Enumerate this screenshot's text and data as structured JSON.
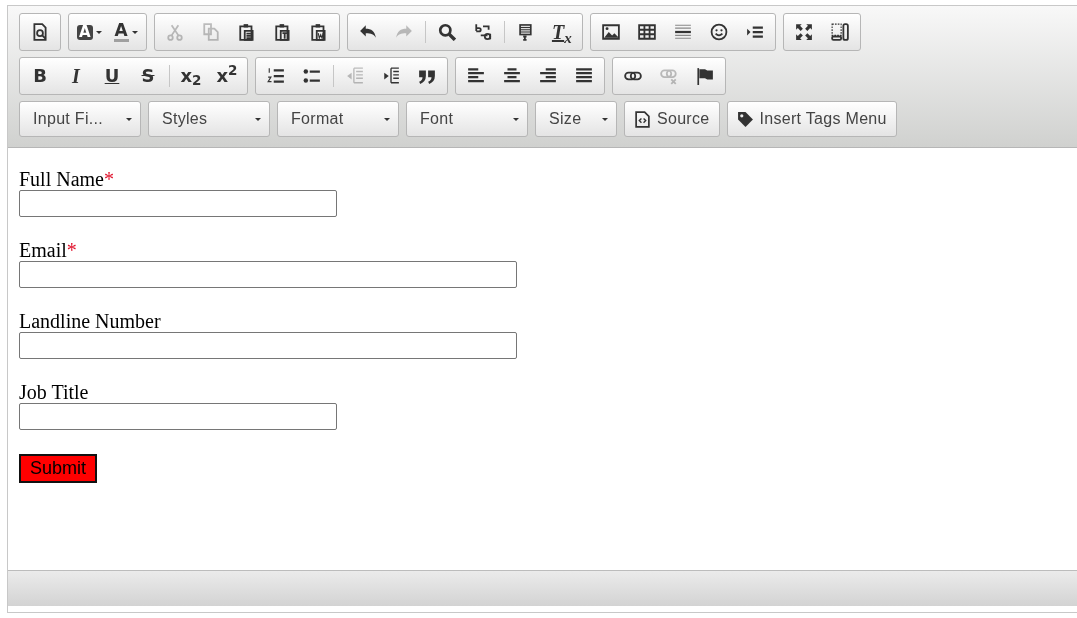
{
  "toolbar": {
    "rows": [
      {
        "groups": [
          [
            {
              "disabled": false
            }
          ],
          [
            {
              "glyph": "A",
              "disabled": false
            },
            {
              "glyph": "A",
              "disabled": false
            }
          ],
          [
            {
              "disabled": true
            },
            {
              "disabled": true
            },
            {
              "disabled": false
            },
            {
              "disabled": false
            },
            {
              "disabled": false
            }
          ],
          [
            {
              "disabled": false
            },
            {
              "disabled": true
            },
            {
              "disabled": false
            },
            {
              "disabled": false
            },
            {
              "disabled": false
            },
            {
              "glyph": "T$_{x}$",
              "disabled": false
            }
          ],
          [
            {
              "disabled": false
            },
            {
              "disabled": false
            },
            {
              "disabled": false
            },
            {
              "disabled": false
            },
            {
              "disabled": false
            }
          ],
          [
            {
              "disabled": false
            },
            {
              "disabled": false
            }
          ]
        ]
      },
      {
        "groups": [
          [
            {
              "glyph": "B",
              "disabled": false
            },
            {
              "glyph": "I",
              "disabled": false
            },
            {
              "glyph": "U",
              "disabled": false
            },
            {
              "glyph": "S",
              "disabled": false
            },
            {
              "glyph": "x$_{2}$",
              "disabled": false
            },
            {
              "glyph": "x$^{2}$",
              "disabled": false
            }
          ],
          [
            {
              "disabled": false
            },
            {
              "disabled": false
            },
            {
              "disabled": true
            },
            {
              "disabled": false
            },
            {
              "disabled": false
            }
          ],
          [
            {
              "disabled": false
            },
            {
              "disabled": false
            },
            {
              "disabled": false
            },
            {
              "disabled": false
            }
          ],
          [
            {
              "disabled": false
            },
            {
              "disabled": true
            },
            {
              "disabled": false
            }
          ]
        ]
      }
    ],
    "combos": [
      "Input Fi...",
      "Styles",
      "Format",
      "Font",
      "Size"
    ],
    "text_buttons": [
      "Source",
      "Insert Tags Menu"
    ]
  },
  "form": {
    "fields": [
      {
        "label": "Full Name",
        "required": true
      },
      {
        "label": "Email",
        "required": true
      },
      {
        "label": "Landline Number",
        "required": false
      },
      {
        "label": "Job Title",
        "required": false
      }
    ],
    "required_mark": "*",
    "submit": "Submit"
  }
}
